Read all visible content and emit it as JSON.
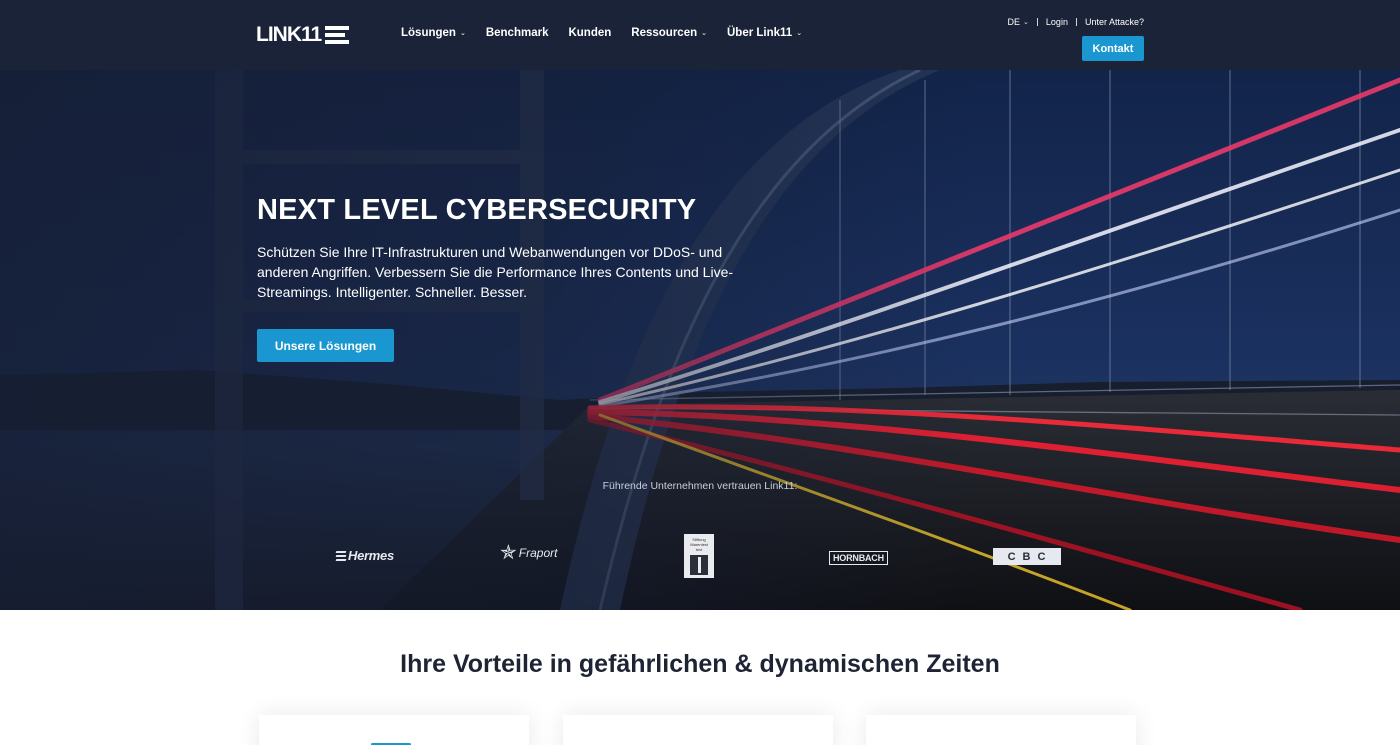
{
  "header": {
    "logo_text": "LINK11",
    "nav": [
      {
        "label": "Lösungen",
        "has_dropdown": true
      },
      {
        "label": "Benchmark",
        "has_dropdown": false
      },
      {
        "label": "Kunden",
        "has_dropdown": false
      },
      {
        "label": "Ressourcen",
        "has_dropdown": true
      },
      {
        "label": "Über Link11",
        "has_dropdown": true
      }
    ],
    "language": "DE",
    "login": "Login",
    "attack": "Unter Attacke?",
    "contact_button": "Kontakt"
  },
  "hero": {
    "title": "NEXT LEVEL CYBERSECURITY",
    "text": "Schützen Sie Ihre IT-Infrastrukturen und Webanwendungen vor DDoS- und anderen Angriffen. Verbessern Sie die Performance Ihres Contents und Live-Streamings. Intelligenter. Schneller. Besser.",
    "button": "Unsere Lösungen",
    "trust_text": "Führende Unternehmen vertrauen Link11:",
    "client_logos": [
      {
        "name": "Hermes",
        "icon": "hermes-logo"
      },
      {
        "name": "Fraport",
        "icon": "fraport-logo"
      },
      {
        "name": "Stiftung Warentest test",
        "icon": "stiftung-warentest-logo"
      },
      {
        "name": "HORNBACH",
        "icon": "hornbach-logo"
      },
      {
        "name": "CBC",
        "icon": "cbc-logo"
      }
    ]
  },
  "benefits": {
    "title": "Ihre Vorteile in gefährlichen & dynamischen Zeiten"
  },
  "colors": {
    "header_bg": "#1b2338",
    "accent": "#1a97d0",
    "text_dark": "#1e2433"
  }
}
